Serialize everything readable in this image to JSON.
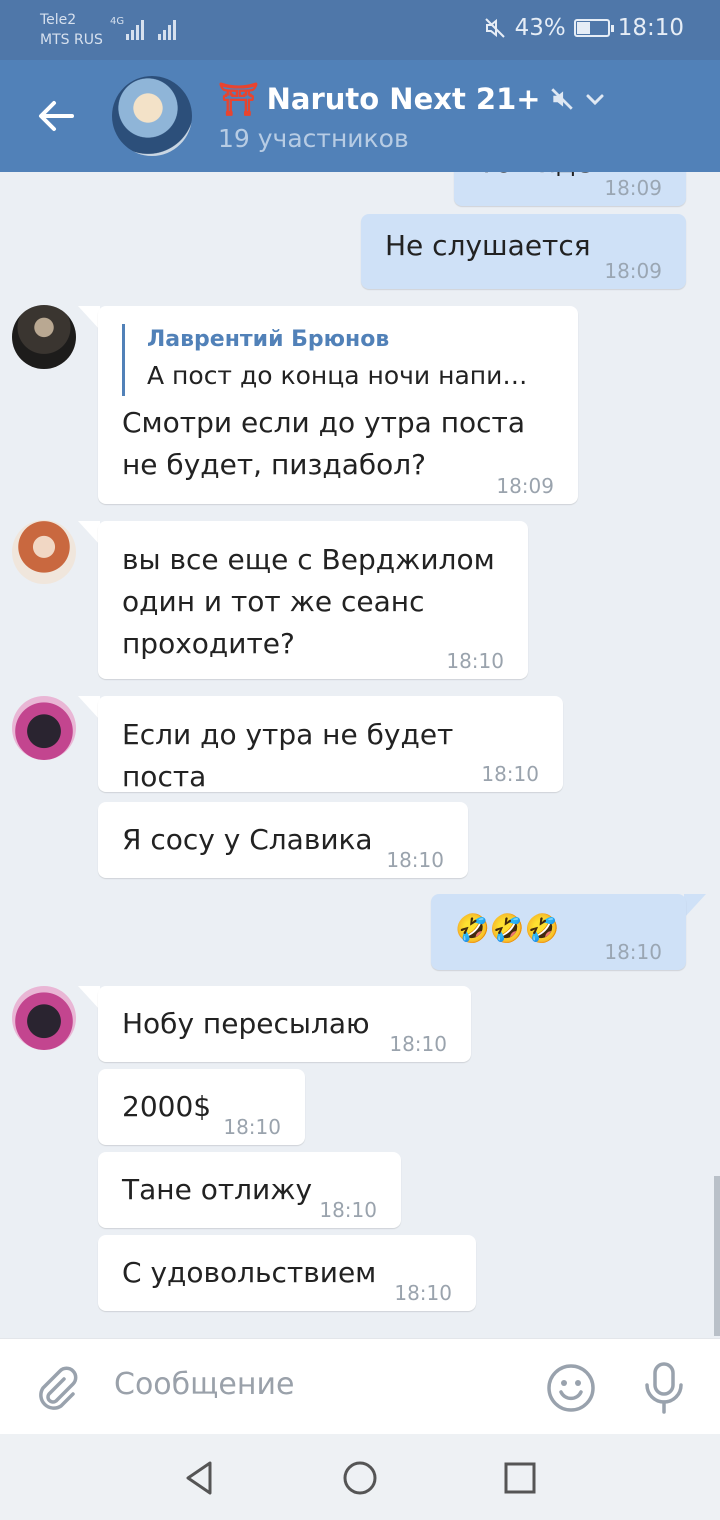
{
  "status_bar": {
    "carrier1": "Tele2",
    "carrier2": "MTS RUS",
    "network": "4G",
    "battery": "43%",
    "battery_level": 0.43,
    "time": "18:10"
  },
  "header": {
    "title": "Naruto Next 21+",
    "subtitle": "19 участников",
    "title_emoji": "⛩"
  },
  "messages": [
    {
      "text": "Тошидё",
      "time": "18:09",
      "direction": "out"
    },
    {
      "text": "Не слушается",
      "time": "18:09",
      "direction": "out"
    },
    {
      "reply_name": "Лаврентий Брюнов",
      "reply_text": "А пост до конца ночи напи…",
      "text_line1": "Смотри если до утра поста",
      "text_line2": "не будет, пиздабол?",
      "time": "18:09",
      "direction": "in"
    },
    {
      "text_line1": "вы все еще с Верджилом",
      "text_line2": "один и тот же сеанс",
      "text_line3": "проходите?",
      "time": "18:10",
      "direction": "in"
    },
    {
      "text": "Если до утра не будет поста",
      "time": "18:10",
      "direction": "in"
    },
    {
      "text": "Я сосу у Славика",
      "time": "18:10",
      "direction": "in"
    },
    {
      "text": "🤣🤣🤣",
      "time": "18:10",
      "direction": "out"
    },
    {
      "text": "Нобу пересылаю",
      "time": "18:10",
      "direction": "in"
    },
    {
      "text": "2000$",
      "time": "18:10",
      "direction": "in"
    },
    {
      "text": "Тане отлижу",
      "time": "18:10",
      "direction": "in"
    },
    {
      "text": "С удовольствием",
      "time": "18:10",
      "direction": "in"
    }
  ],
  "composer": {
    "placeholder": "Сообщение"
  },
  "colors": {
    "header": "#5181b8",
    "status_bar": "#4f77a9",
    "outgoing_bubble": "#cfe1f7",
    "incoming_bubble": "#ffffff",
    "chat_background": "#ebeff4"
  }
}
